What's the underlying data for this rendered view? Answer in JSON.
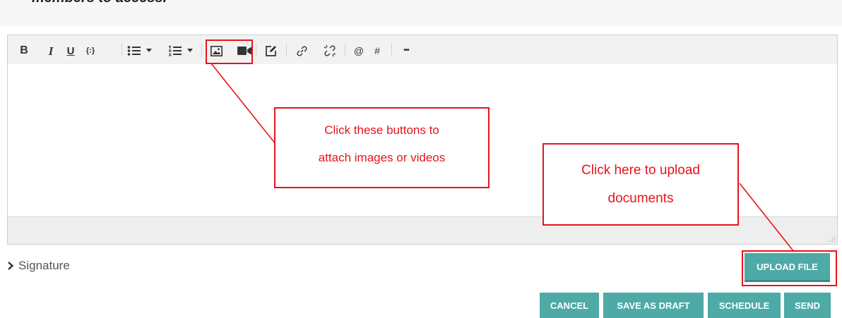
{
  "page": {
    "partial_heading": "members to access."
  },
  "editor": {
    "toolbar": {
      "bold_label": "B",
      "italic_label": "I",
      "underline_label": "U",
      "code_label": "{:}",
      "mention_label": "@",
      "hashtag_label": "#",
      "more_label": "•••"
    },
    "body_text": ""
  },
  "annotations": {
    "media_note": [
      "Click these buttons to",
      "attach images or videos"
    ],
    "upload_note": [
      "Click here to upload",
      "documents"
    ],
    "color": "#e8131b"
  },
  "signature": {
    "label": "Signature"
  },
  "actions": {
    "upload_file": "UPLOAD FILE",
    "cancel": "CANCEL",
    "save_as_draft": "SAVE AS DRAFT",
    "schedule": "SCHEDULE",
    "send": "SEND"
  },
  "colors": {
    "button_bg": "#4daaa6",
    "annotation": "#e8131b"
  }
}
